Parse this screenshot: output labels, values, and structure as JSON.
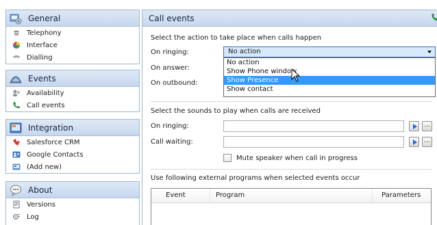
{
  "sidebar": {
    "groups": [
      {
        "title": "General",
        "icon": "general-icon",
        "items": [
          {
            "label": "Telephony",
            "icon": "telephony-icon"
          },
          {
            "label": "Interface",
            "icon": "interface-icon"
          },
          {
            "label": "Dialling",
            "icon": "dialling-icon"
          }
        ]
      },
      {
        "title": "Events",
        "icon": "events-icon",
        "items": [
          {
            "label": "Availability",
            "icon": "availability-icon"
          },
          {
            "label": "Call events",
            "icon": "call-events-icon"
          }
        ]
      },
      {
        "title": "Integration",
        "icon": "integration-icon",
        "items": [
          {
            "label": "Salesforce CRM",
            "icon": "salesforce-icon"
          },
          {
            "label": "Google Contacts",
            "icon": "google-contacts-icon"
          },
          {
            "label": "(Add new)",
            "icon": "add-new-icon"
          }
        ]
      },
      {
        "title": "About",
        "icon": "about-icon",
        "items": [
          {
            "label": "Versions",
            "icon": "versions-icon"
          },
          {
            "label": "Log",
            "icon": "log-icon"
          }
        ]
      }
    ]
  },
  "main": {
    "title": "Call events",
    "actions_heading": "Select the action to take place when calls happen",
    "on_ringing_label": "On ringing:",
    "on_answer_label": "On answer:",
    "on_outbound_label": "On outbound:",
    "ringing_action_value": "No action",
    "dropdown_options": [
      "No action",
      "Show Phone window",
      "Show Presence",
      "Show contact"
    ],
    "dropdown_highlighted": "Show Presence",
    "sounds_heading": "Select the sounds to play when calls are received",
    "sound_ringing_label": "On ringing:",
    "sound_waiting_label": "Call waiting:",
    "sound_ringing_value": "",
    "sound_waiting_value": "",
    "browse_label": "...",
    "mute_label": "Mute speaker when call in progress",
    "mute_checked": false,
    "programs_heading": "Use following external programs when selected events occur",
    "table_columns": [
      "Event",
      "Program",
      "Parameters"
    ],
    "table_rows": []
  },
  "colors": {
    "header_gradient_top": "#dfe9f6",
    "header_gradient_bottom": "#c6d7ed",
    "border": "#9fb6d1",
    "selected_option": "#3399ff",
    "select_background": "#d7e9fb",
    "play_accent": "#1a6ed8"
  }
}
